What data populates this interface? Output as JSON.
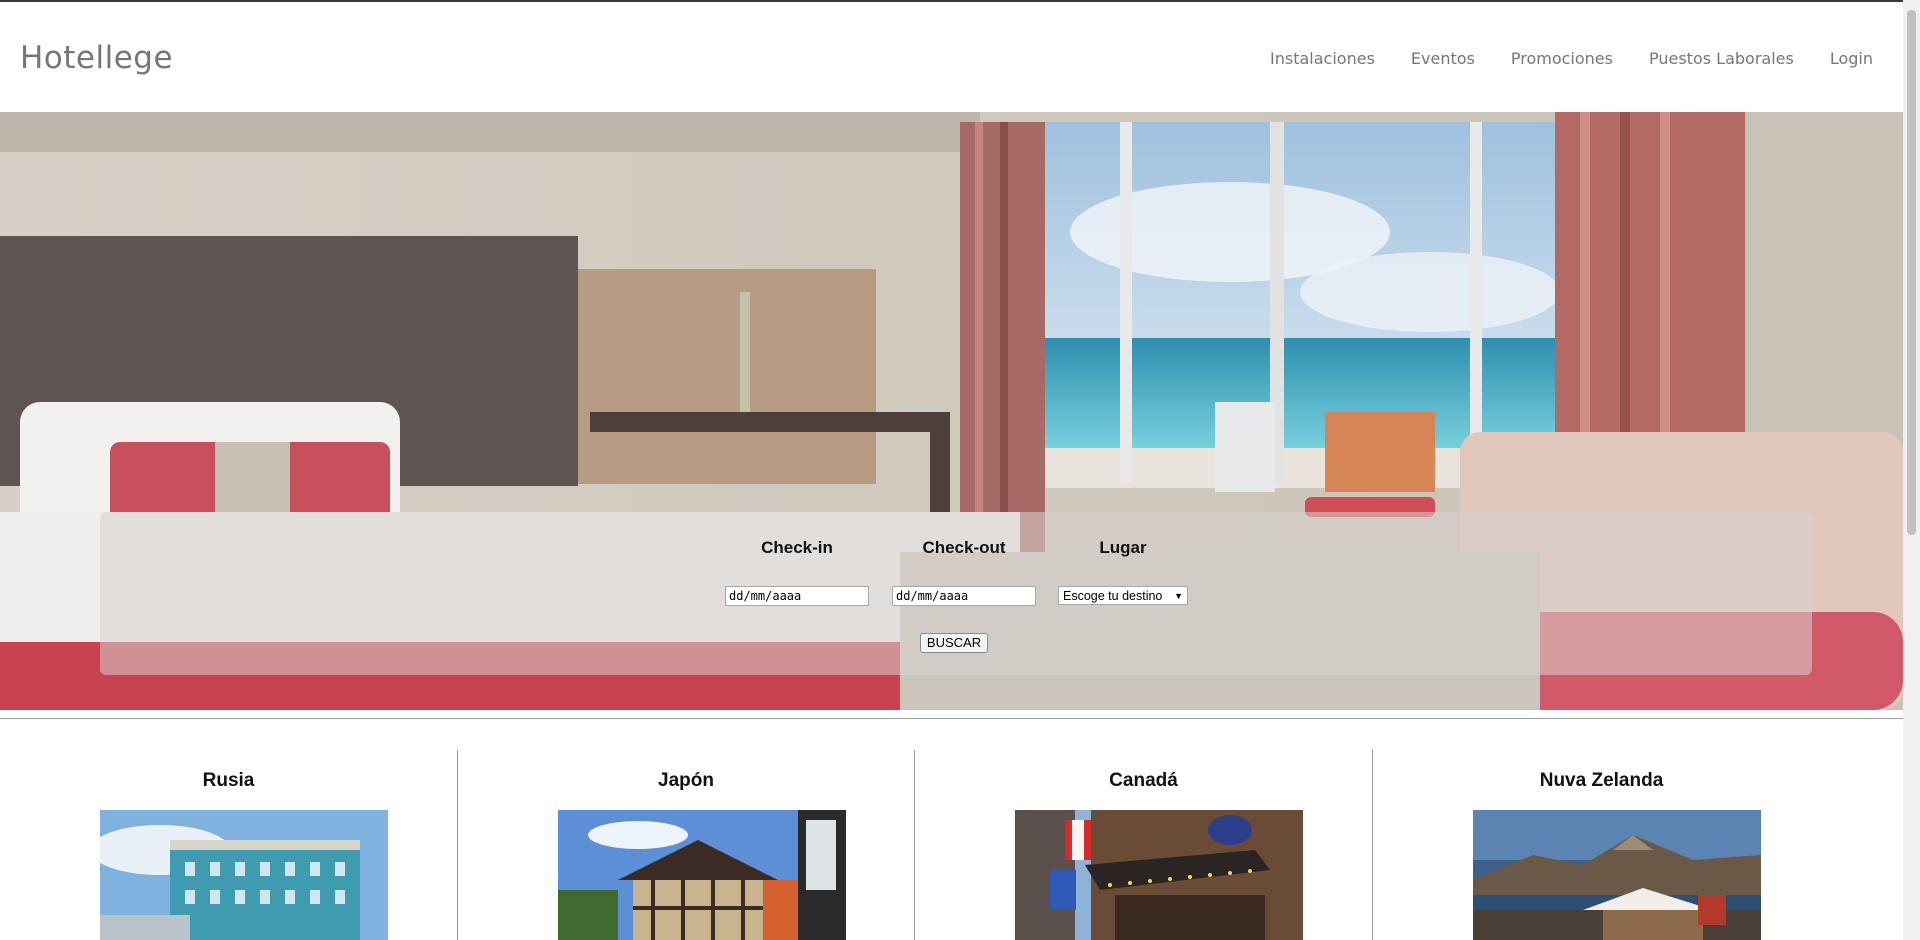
{
  "header": {
    "logo": "Hotellege",
    "nav": [
      {
        "label": "Instalaciones"
      },
      {
        "label": "Eventos"
      },
      {
        "label": "Promociones"
      },
      {
        "label": "Puestos Laborales"
      },
      {
        "label": "Login"
      }
    ]
  },
  "search": {
    "checkin_label": "Check-in",
    "checkout_label": "Check-out",
    "lugar_label": "Lugar",
    "checkin_placeholder": "dd/mm/aaaa",
    "checkout_placeholder": "dd/mm/aaaa",
    "lugar_selected": "Escoge tu destino",
    "button_label": "BUSCAR"
  },
  "destinations": [
    {
      "name": "Rusia"
    },
    {
      "name": "Japón"
    },
    {
      "name": "Canadá"
    },
    {
      "name": "Nuva Zelanda"
    }
  ]
}
